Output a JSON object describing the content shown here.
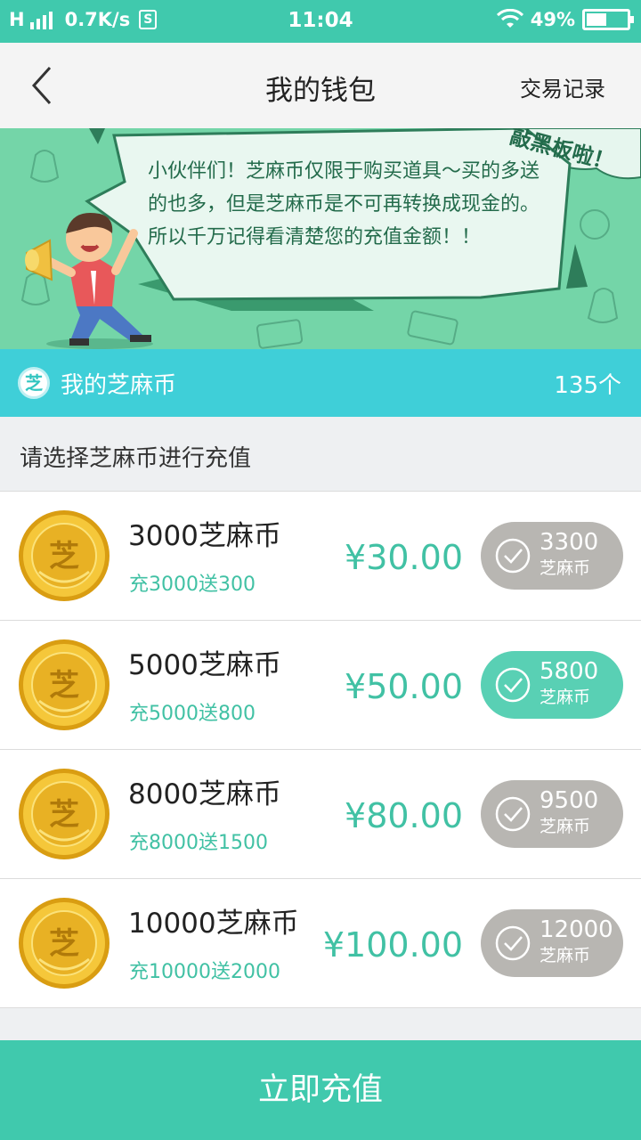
{
  "status_bar": {
    "network": "H",
    "speed": "0.7K/s",
    "speed_icon": "S",
    "time": "11:04",
    "battery": "49%",
    "battery_level": 0.49
  },
  "header": {
    "back_icon": "chevron-left-icon",
    "title": "我的钱包",
    "right_link": "交易记录"
  },
  "banner": {
    "message": "小伙伴们！芝麻币仅限于购买道具～买的多送的也多，但是芝麻币是不可再转换成现金的。所以千万记得看清楚您的充值金额！！",
    "tag": "敲黑板啦！"
  },
  "balance": {
    "icon": "芝",
    "label": "我的芝麻币",
    "value": "135个"
  },
  "section_title": "请选择芝麻币进行充值",
  "packages": [
    {
      "name": "3000芝麻币",
      "bonus": "充3000送300",
      "price": "¥30.00",
      "total": "3300",
      "unit": "芝麻币",
      "selected": false
    },
    {
      "name": "5000芝麻币",
      "bonus": "充5000送800",
      "price": "¥50.00",
      "total": "5800",
      "unit": "芝麻币",
      "selected": true
    },
    {
      "name": "8000芝麻币",
      "bonus": "充8000送1500",
      "price": "¥80.00",
      "total": "9500",
      "unit": "芝麻币",
      "selected": false
    },
    {
      "name": "10000芝麻币",
      "bonus": "充10000送2000",
      "price": "¥100.00",
      "total": "12000",
      "unit": "芝麻币",
      "selected": false
    }
  ],
  "coin_glyph": "芝",
  "action": {
    "label": "立即充值"
  },
  "colors": {
    "accent": "#40c9ad",
    "balance_bar": "#3fcfd8",
    "selected_pill": "#59d0b4",
    "unselected_pill": "#b8b6b2",
    "price": "#41c1a4"
  }
}
